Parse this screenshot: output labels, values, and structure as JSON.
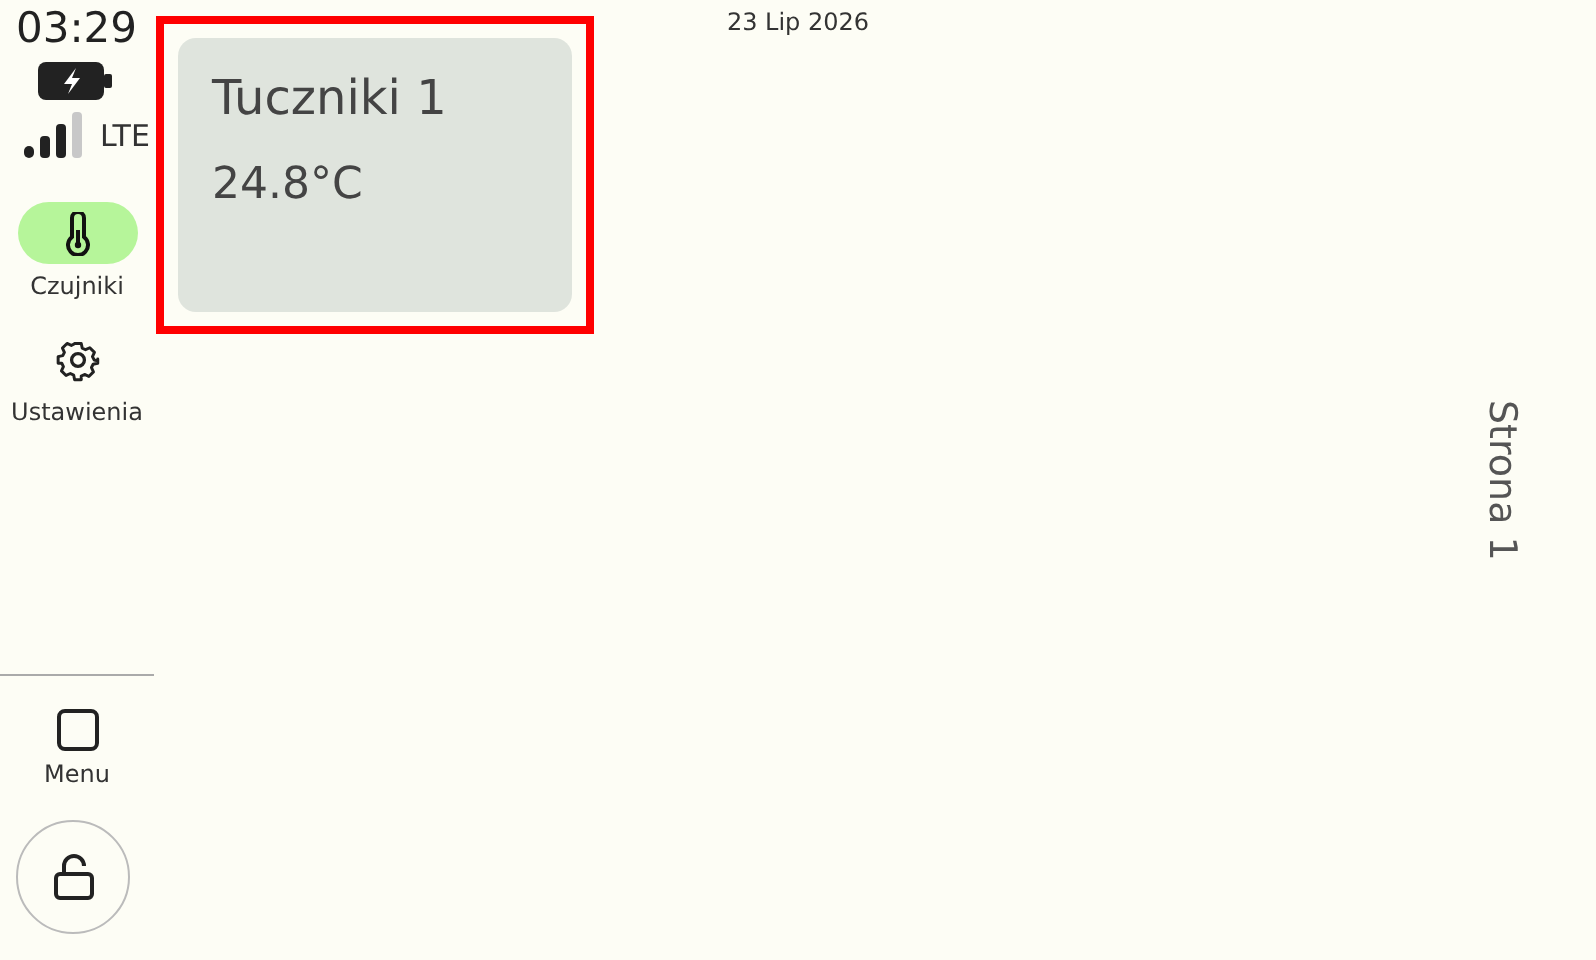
{
  "status": {
    "time": "03:29",
    "network": "LTE",
    "date": "23 Lip 2026"
  },
  "nav": [
    {
      "label": "Czujniki",
      "kind": "thermometer",
      "selected": true
    },
    {
      "label": "Ustawienia",
      "kind": "gear",
      "selected": false
    }
  ],
  "menu": {
    "label": "Menu"
  },
  "tiles": [
    {
      "name": "Tuczniki 1",
      "temperature": "24.8°C",
      "selected": true
    }
  ],
  "page_label": "Strona 1"
}
